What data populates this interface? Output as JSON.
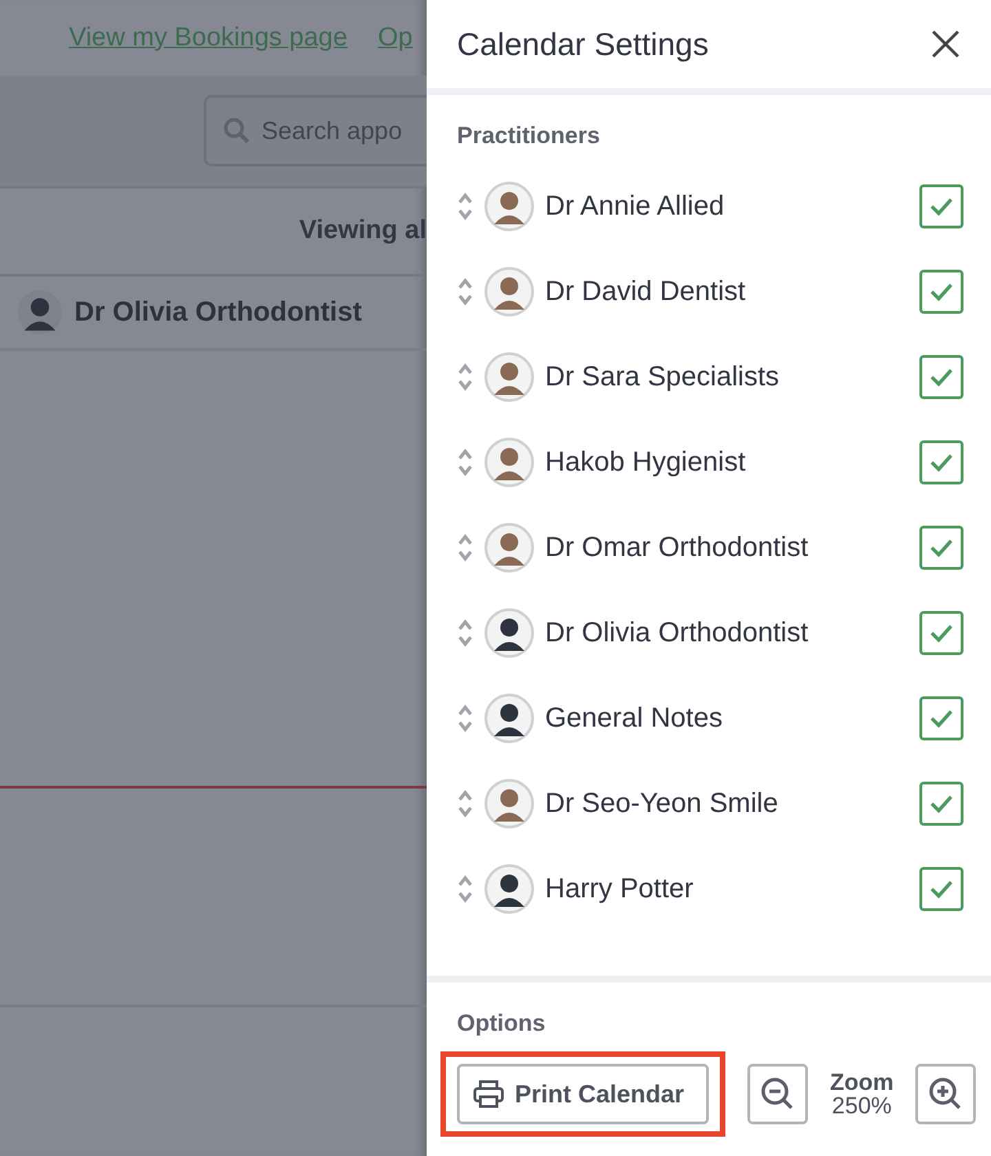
{
  "background": {
    "links": [
      "View my Bookings page",
      "Op"
    ],
    "search": {
      "placeholder": "Search appo"
    },
    "header": "Viewing al",
    "practitioner": "Dr Olivia Orthodontist"
  },
  "panel": {
    "title": "Calendar Settings",
    "section": "Practitioners",
    "practitioners": [
      {
        "name": "Dr Annie Allied",
        "kind": "illustrated",
        "checked": true
      },
      {
        "name": "Dr David Dentist",
        "kind": "illustrated",
        "checked": true
      },
      {
        "name": "Dr Sara Specialists",
        "kind": "illustrated",
        "checked": true
      },
      {
        "name": "Hakob Hygienist",
        "kind": "illustrated",
        "checked": true
      },
      {
        "name": "Dr Omar Orthodontist",
        "kind": "illustrated",
        "checked": true
      },
      {
        "name": "Dr Olivia Orthodontist",
        "kind": "silhouette",
        "checked": true
      },
      {
        "name": "General Notes",
        "kind": "silhouette",
        "checked": true
      },
      {
        "name": "Dr Seo-Yeon Smile",
        "kind": "illustrated",
        "checked": true
      },
      {
        "name": "Harry Potter",
        "kind": "silhouette",
        "checked": true
      }
    ],
    "options": {
      "title": "Options",
      "print": "Print Calendar",
      "zoom_label": "Zoom",
      "zoom_value": "250%"
    }
  }
}
